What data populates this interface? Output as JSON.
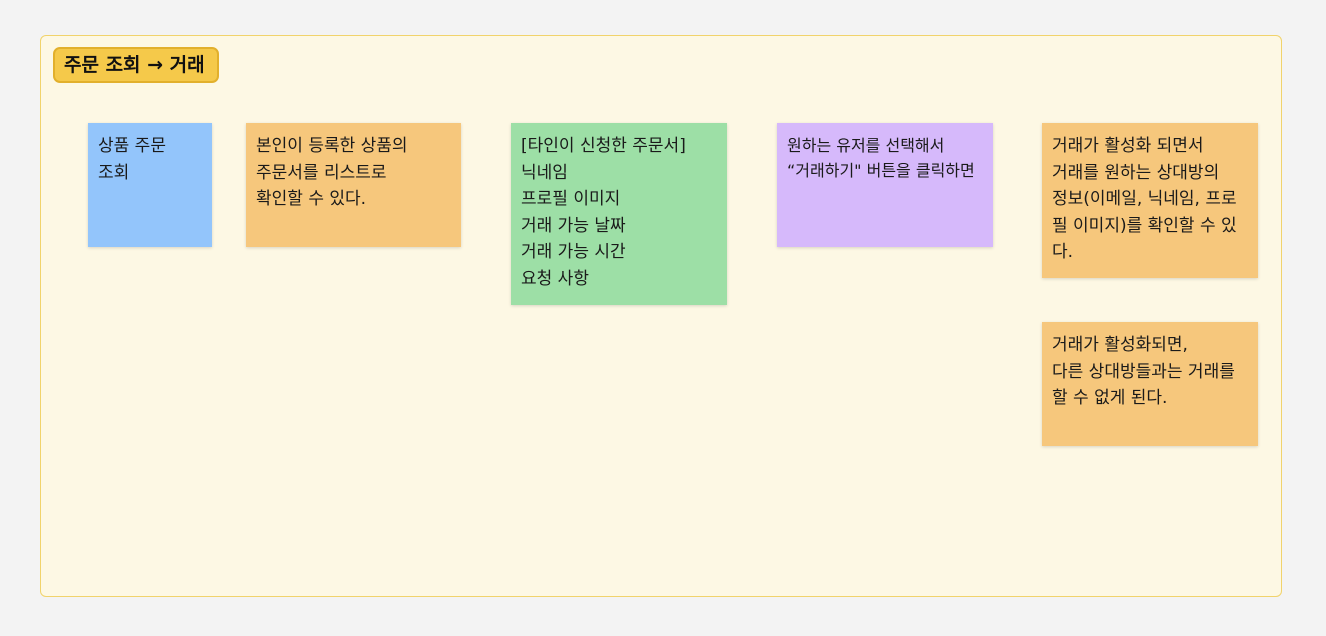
{
  "section": {
    "title": "주문 조회 → 거래",
    "background": "#fdf8e4",
    "border": "#f1d36b",
    "title_color": "#f5c94a"
  },
  "notes": [
    {
      "id": "note-product-order",
      "text": "상품 주문\n조회",
      "color": "#93c5fb"
    },
    {
      "id": "note-own-orders",
      "text": "본인이 등록한 상품의\n주문서를 리스트로\n확인할 수 있다.",
      "color": "#f6c77c"
    },
    {
      "id": "note-other-orders",
      "text": "[타인이 신청한 주문서]\n닉네임\n프로필 이미지\n거래 가능 날짜\n거래 가능 시간\n요청 사항",
      "color": "#9ddfa6"
    },
    {
      "id": "note-select-user",
      "text": "원하는 유저를 선택해서\n“거래하기\" 버튼을 클릭하면",
      "color": "#d6b9fb"
    },
    {
      "id": "note-trade-active",
      "text": "거래가 활성화 되면서\n거래를 원하는 상대방의\n정보(이메일, 닉네임, 프로필 이미지)를 확인할 수 있다.",
      "color": "#f6c77c"
    },
    {
      "id": "note-trade-locked",
      "text": "거래가 활성화되면,\n다른 상대방들과는 거래를\n할 수 없게 된다.",
      "color": "#f6c77c"
    }
  ]
}
